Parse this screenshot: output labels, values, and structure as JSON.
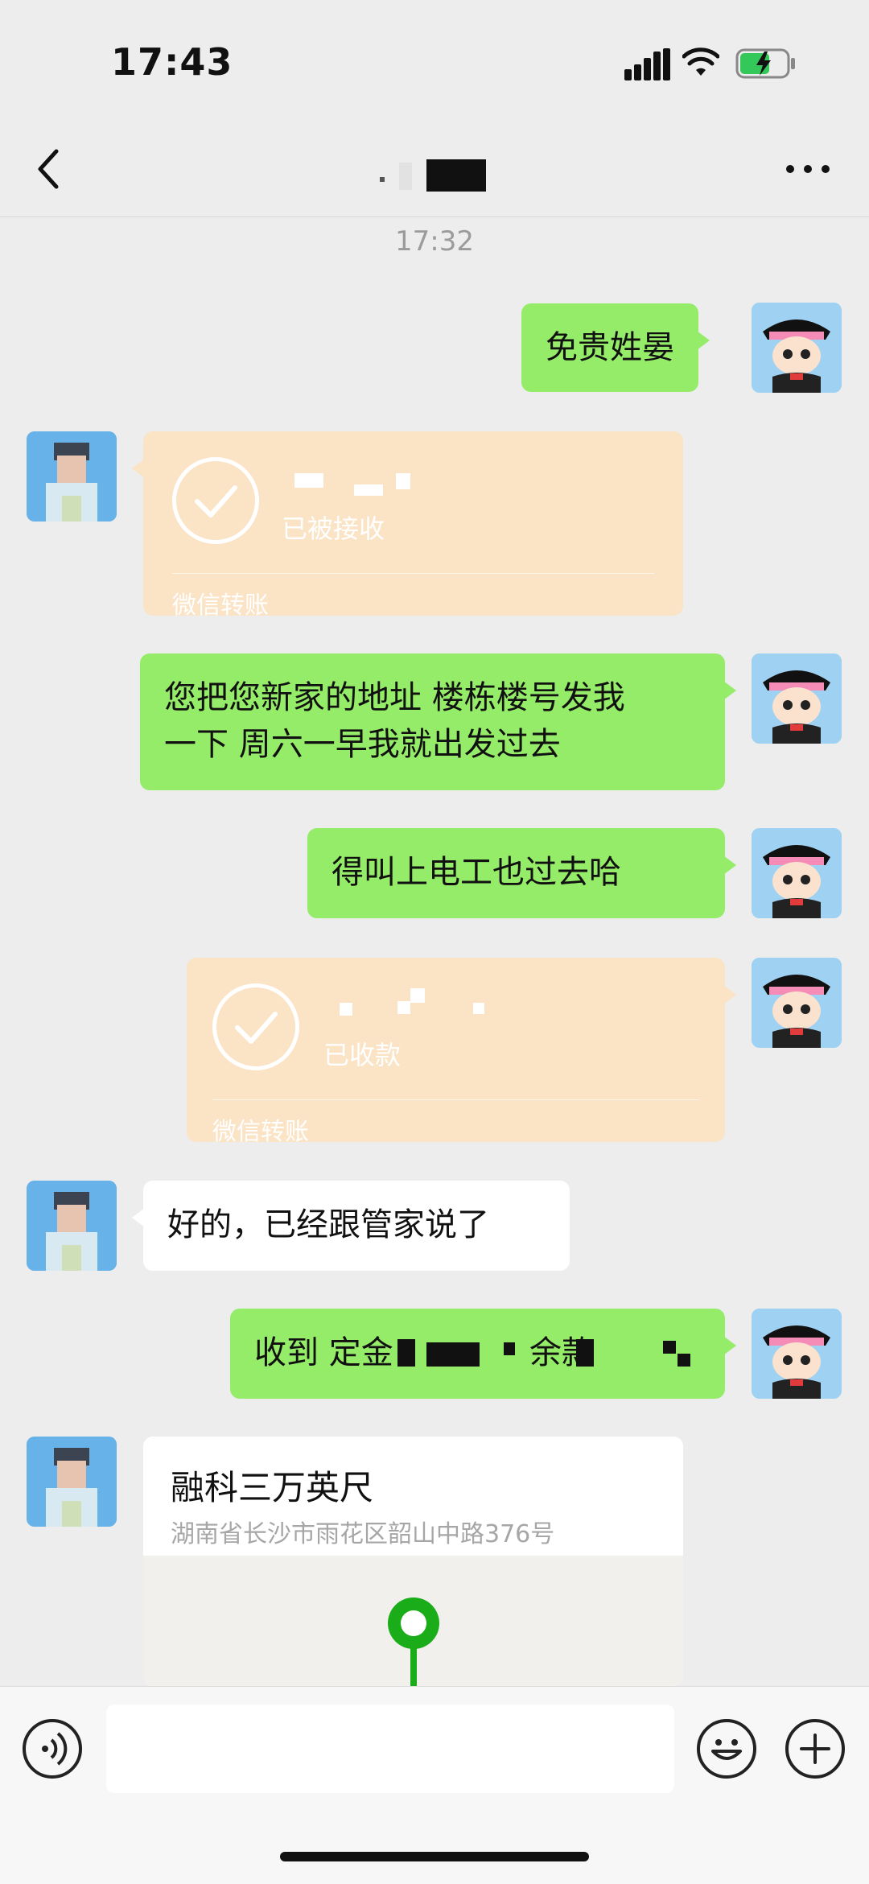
{
  "status_bar": {
    "time": "17:43"
  },
  "chat": {
    "timestamp": "17:32",
    "messages": [
      {
        "side": "me",
        "type": "text",
        "text": "免贵姓晏"
      },
      {
        "side": "other",
        "type": "transfer",
        "status": "已被接收",
        "footer": "微信转账"
      },
      {
        "side": "me",
        "type": "text",
        "line1": "您把您新家的地址 楼栋楼号发我",
        "line2": "一下  周六一早我就出发过去"
      },
      {
        "side": "me",
        "type": "text",
        "text": "得叫上电工也过去哈"
      },
      {
        "side": "me",
        "type": "transfer",
        "status": "已收款",
        "footer": "微信转账"
      },
      {
        "side": "other",
        "type": "text",
        "text": "好的，已经跟管家说了"
      },
      {
        "side": "me",
        "type": "text",
        "text_a": "收到 定金",
        "text_b": "余款"
      },
      {
        "side": "other",
        "type": "location",
        "name": "融科三万英尺",
        "address": "湖南省长沙市雨花区韶山中路376号"
      }
    ]
  },
  "colors": {
    "bg": "#ededed",
    "me_bubble": "#95ec69",
    "other_bubble": "#ffffff",
    "transfer_bubble": "#fbe3c5",
    "pin": "#1aad19"
  },
  "icons": {
    "back": "chevron-left-icon",
    "more": "more-icon",
    "voice": "voice-icon",
    "emoji": "emoji-icon",
    "plus": "plus-icon"
  }
}
